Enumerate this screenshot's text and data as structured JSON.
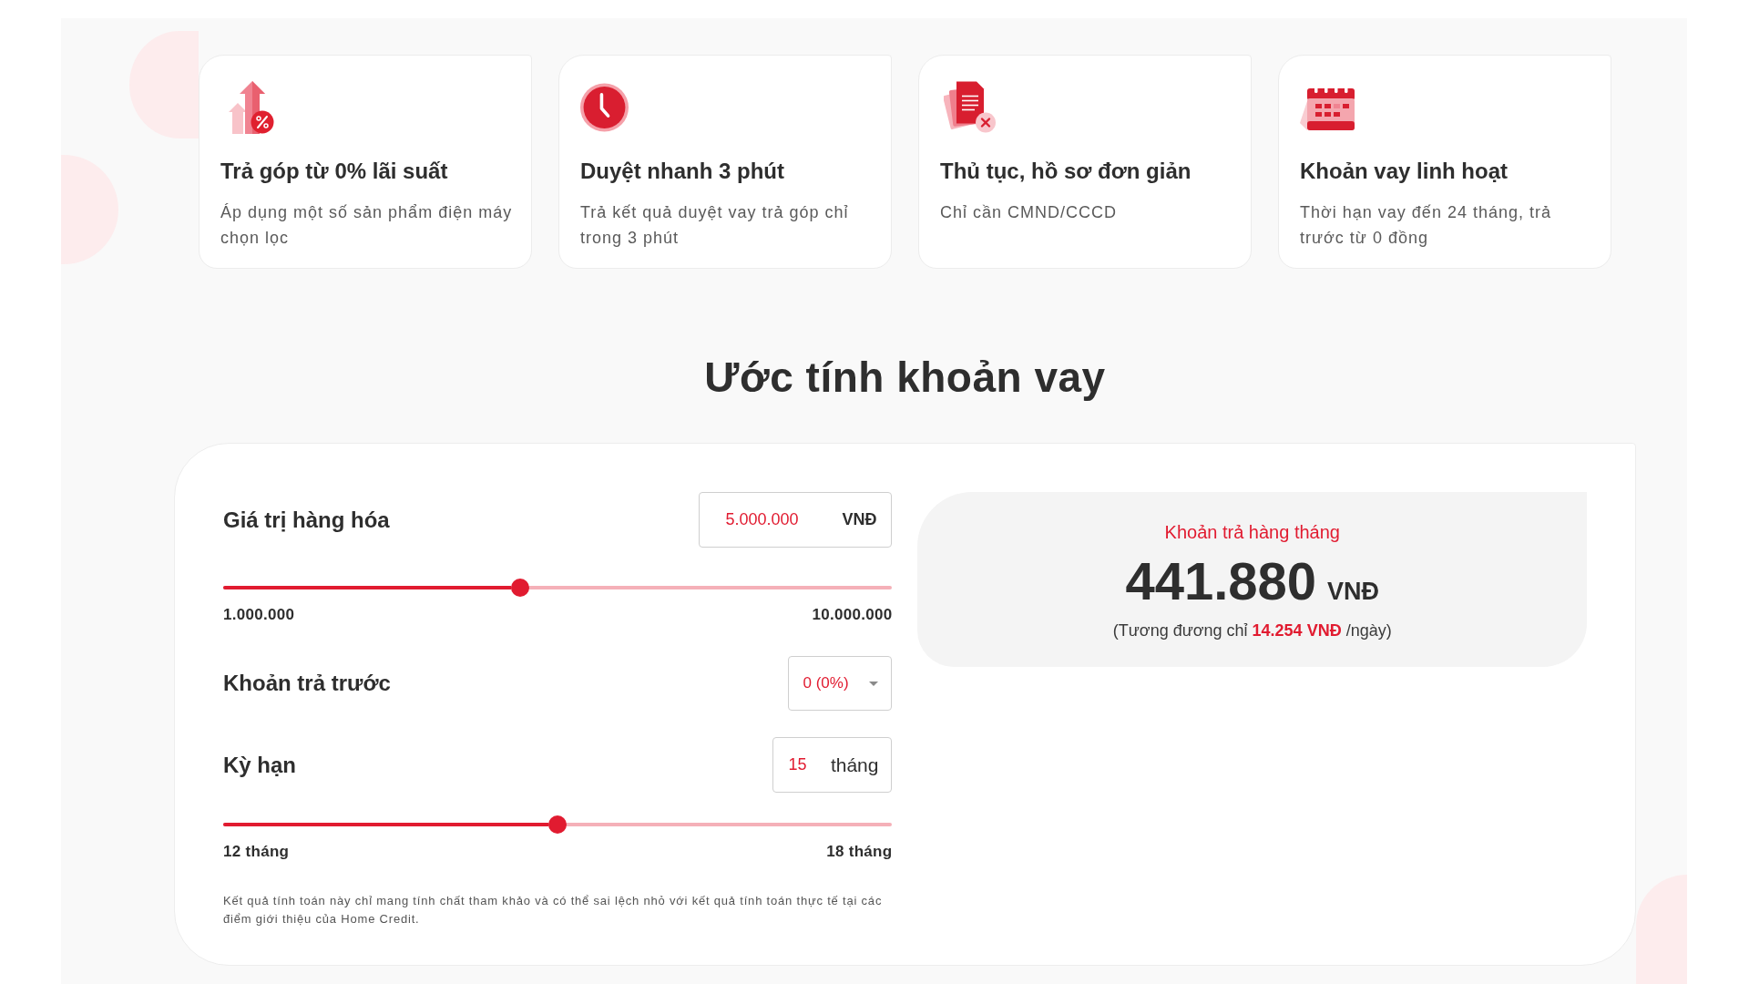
{
  "features": [
    {
      "title": "Trả góp từ 0% lãi suất",
      "description": "Áp dụng một số sản phẩm điện máy chọn lọc"
    },
    {
      "title": "Duyệt nhanh 3 phút",
      "description": "Trả kết quả duyệt vay trả góp chỉ trong 3 phút"
    },
    {
      "title": "Thủ tục, hồ sơ đơn giản",
      "description": "Chỉ cần CMND/CCCD"
    },
    {
      "title": "Khoản vay linh hoạt",
      "description": "Thời hạn vay đến 24 tháng, trả trước từ 0 đồng"
    }
  ],
  "estimator": {
    "title": "Ước tính khoản vay",
    "product_value": {
      "label": "Giá trị hàng hóa",
      "value": "5.000.000",
      "unit": "VNĐ",
      "level": 0.444,
      "min_label": "1.000.000",
      "max_label": "10.000.000"
    },
    "down_payment": {
      "label": "Khoản trả trước",
      "value": "0 (0%)"
    },
    "term": {
      "label": "Kỳ hạn",
      "value": "15",
      "unit": "tháng",
      "level": 0.5,
      "min_label": "12 tháng",
      "max_label": "18 tháng"
    },
    "disclaimer": "Kết quả tính toán này chỉ mang tính chất tham khảo và có thể sai lệch nhỏ với kết quả tính toán thực tế tại các điểm giới thiệu của Home Credit.",
    "result": {
      "label": "Khoản trả hàng tháng",
      "amount": "441.880",
      "currency": "VNĐ",
      "daily_note": "(Tương đương chỉ **14.254 VNĐ** /ngày)"
    }
  }
}
